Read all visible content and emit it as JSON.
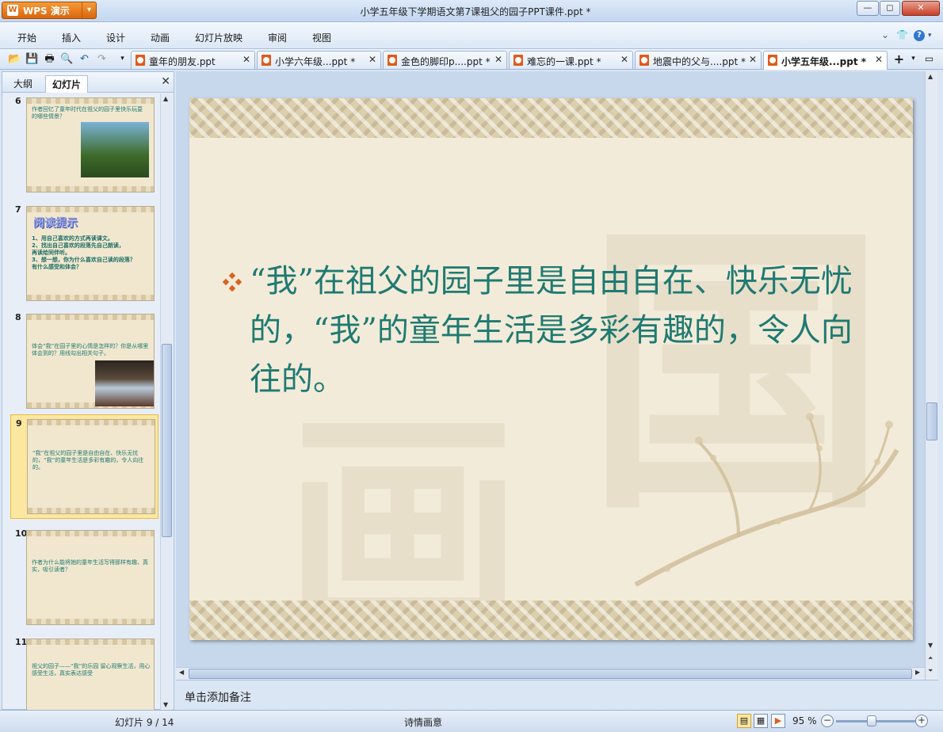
{
  "window": {
    "app_button": "WPS 演示",
    "title": "小学五年级下学期语文第7课祖父的园子PPT课件.ppt *",
    "controls": [
      "minimize",
      "maximize",
      "close"
    ]
  },
  "menu": {
    "items": [
      "开始",
      "插入",
      "设计",
      "动画",
      "幻灯片放映",
      "审阅",
      "视图"
    ]
  },
  "tabs": [
    {
      "label": "童年的朋友.ppt"
    },
    {
      "label": "小学六年级...ppt *"
    },
    {
      "label": "金色的脚印p....ppt *"
    },
    {
      "label": "难忘的一课.ppt *"
    },
    {
      "label": "地震中的父与....ppt *"
    },
    {
      "label": "小学五年级...ppt *"
    }
  ],
  "left_panel": {
    "tab_outline": "大纲",
    "tab_slides": "幻灯片",
    "thumbnails": [
      {
        "num": "6",
        "text": "作者回忆了童年时代在祖父的园子里快乐玩耍的哪些情景？"
      },
      {
        "num": "7",
        "title": "阅读提示",
        "lines": [
          "1、用自己喜欢的方式再读课文。",
          "2、找出自己喜欢的段落先自己朗读，",
          "   再读给同伴听。",
          "3、想一想，你为什么喜欢自己读的段落？",
          "   有什么感受和体会？"
        ]
      },
      {
        "num": "8",
        "text": "体会“我”在园子里的心情是怎样的？你是从哪里体会到的？用线勾出相关句子。"
      },
      {
        "num": "9",
        "text": "“我”在祖父的园子里是自由自在、快乐无忧的，“我”的童年生活是多彩有趣的，令人向往的。"
      },
      {
        "num": "10",
        "text": "作者为什么能将她的童年生活写得那样有趣、真实，吸引读者？"
      },
      {
        "num": "11",
        "text": "祖父的园子——“我”的乐园 留心观察生活，用心感受生活，真实表达感受"
      }
    ]
  },
  "slide": {
    "body": "“我”在祖父的园子里是自由自在、快乐无忧的，“我”的童年生活是多彩有趣的，令人向往的。"
  },
  "notes": {
    "placeholder": "单击添加备注"
  },
  "status": {
    "slide_counter": "幻灯片 9 / 14",
    "theme": "诗情画意",
    "zoom": "95 %"
  }
}
